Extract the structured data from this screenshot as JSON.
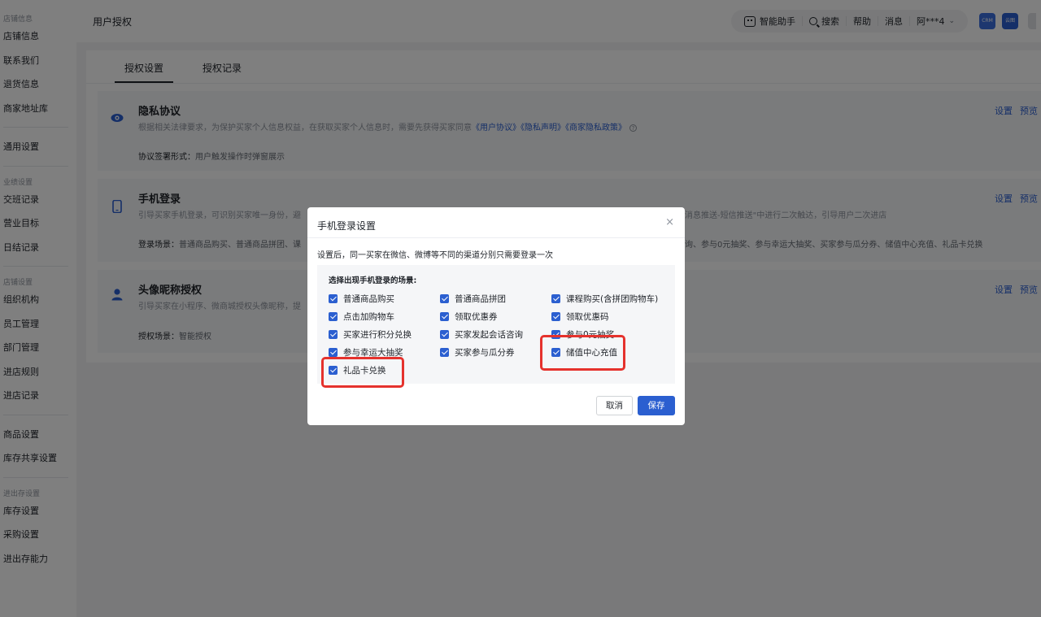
{
  "sidebar": {
    "group1_title": "店铺信息",
    "group1": [
      "店铺信息",
      "联系我们",
      "退货信息",
      "商家地址库"
    ],
    "general": "通用设置",
    "group2_title": "业绩设置",
    "group2": [
      "交班记录",
      "营业目标",
      "日结记录"
    ],
    "group3_title": "店铺设置",
    "group3": [
      "组织机构",
      "员工管理",
      "部门管理",
      "进店规则",
      "进店记录"
    ],
    "group4": [
      "商品设置",
      "库存共享设置"
    ],
    "group5_title": "进出存设置",
    "group5": [
      "库存设置",
      "采购设置",
      "进出存能力"
    ]
  },
  "header": {
    "title": "用户授权",
    "ai": "智能助手",
    "search": "搜索",
    "help": "帮助",
    "messages": "消息",
    "user": "阿***4",
    "app1": "CRM",
    "app2": "云图"
  },
  "tabs": [
    "授权设置",
    "授权记录"
  ],
  "sections": {
    "privacy": {
      "title": "隐私协议",
      "desc": "根据相关法律要求，为保护买家个人信息权益，在获取买家个人信息时，需要先获得买家同意",
      "links": "《用户协议》《隐私声明》《商家隐私政策》",
      "extra_label": "协议签署形式：",
      "extra_value": "用户触发操作时弹窗展示"
    },
    "phone": {
      "title": "手机登录",
      "desc": "引导买家手机登录，可识别买家唯一身份，避",
      "desc_tail": "消息推送-短信推送\"中进行二次触达，引导用户二次进店",
      "extra_label": "登录场景：",
      "extra_value": "普通商品购买、普通商品拼团、课",
      "extra_tail": "询、参与0元抽奖、参与幸运大抽奖、买家参与瓜分券、储值中心充值、礼品卡兑换"
    },
    "avatar": {
      "title": "头像昵称授权",
      "desc": "引导买家在小程序、微商城授权头像昵称，提",
      "extra_label": "授权场景：",
      "extra_value": "智能授权"
    },
    "link_settings": "设置",
    "link_preview": "预览"
  },
  "modal": {
    "title": "手机登录设置",
    "close": "×",
    "desc": "设置后，同一买家在微信、微博等不同的渠道分别只需要登录一次",
    "heading": "选择出现手机登录的场景:",
    "options": [
      "普通商品购买",
      "普通商品拼团",
      "课程购买(含拼团购物车)",
      "点击加购物车",
      "领取优惠券",
      "领取优惠码",
      "买家进行积分兑换",
      "买家发起会话咨询",
      "参与0元抽奖",
      "参与幸运大抽奖",
      "买家参与瓜分券",
      "储值中心充值",
      "礼品卡兑换"
    ],
    "cancel": "取消",
    "save": "保存"
  }
}
